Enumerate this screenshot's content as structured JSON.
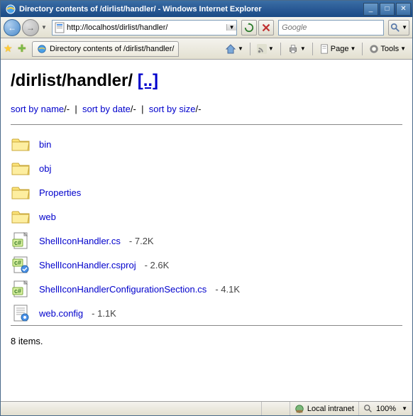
{
  "window": {
    "title": "Directory contents of /dirlist/handler/ - Windows Internet Explorer"
  },
  "address": {
    "url": "http://localhost/dirlist/handler/"
  },
  "search": {
    "placeholder": "Google"
  },
  "tab": {
    "title": "Directory contents of /dirlist/handler/"
  },
  "toolbar": {
    "page_label": "Page",
    "tools_label": "Tools"
  },
  "page": {
    "heading_path": "/dirlist/handler/",
    "parent_link": "[..]",
    "sort": {
      "by_name": "sort by name",
      "by_date": "sort by date",
      "by_size": "sort by size",
      "desc": "/-",
      "sep": "|"
    },
    "items": [
      {
        "icon": "folder",
        "name": "bin",
        "size": ""
      },
      {
        "icon": "folder",
        "name": "obj",
        "size": ""
      },
      {
        "icon": "folder",
        "name": "Properties",
        "size": ""
      },
      {
        "icon": "folder",
        "name": "web",
        "size": ""
      },
      {
        "icon": "cs",
        "name": "ShellIconHandler.cs",
        "size": "7.2K"
      },
      {
        "icon": "csproj",
        "name": "ShellIconHandler.csproj",
        "size": "2.6K"
      },
      {
        "icon": "cs",
        "name": "ShellIconHandlerConfigurationSection.cs",
        "size": "4.1K"
      },
      {
        "icon": "config",
        "name": "web.config",
        "size": "1.1K"
      }
    ],
    "count_text": "8 items."
  },
  "status": {
    "zone": "Local intranet",
    "zoom": "100%"
  }
}
